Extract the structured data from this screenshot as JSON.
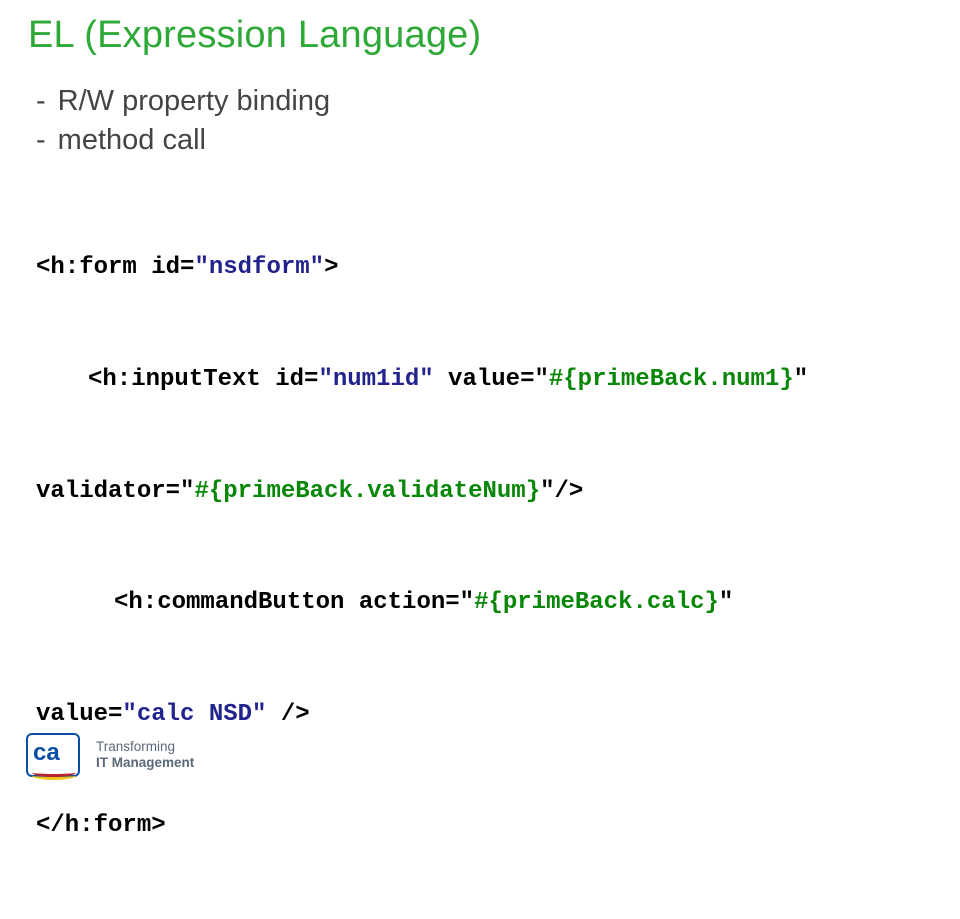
{
  "title": "EL (Expression Language)",
  "bullets": {
    "b1": "R/W property binding",
    "b2": "method call"
  },
  "code": {
    "l1_a": "<h:form id=",
    "l1_b": "\"nsdform\"",
    "l1_c": ">",
    "l2_a": "<h:inputText id=",
    "l2_b": "\"num1id\"",
    "l2_c": " value=\"",
    "l2_d": "#{primeBack.num1}",
    "l2_e": "\"",
    "l3_a": "validator=\"",
    "l3_b": "#{primeBack.validateNum}",
    "l3_c": "\"/>",
    "l4_a": "<h:commandButton action=\"",
    "l4_b": "#{primeBack.calc}",
    "l4_c": "\"",
    "l5_a": "value=",
    "l5_b": "\"calc NSD\"",
    "l5_c": " />",
    "l6": "</h:form>"
  },
  "footer": {
    "logo_text": "ca",
    "tag1": "Transforming",
    "tag2": "IT Management"
  }
}
